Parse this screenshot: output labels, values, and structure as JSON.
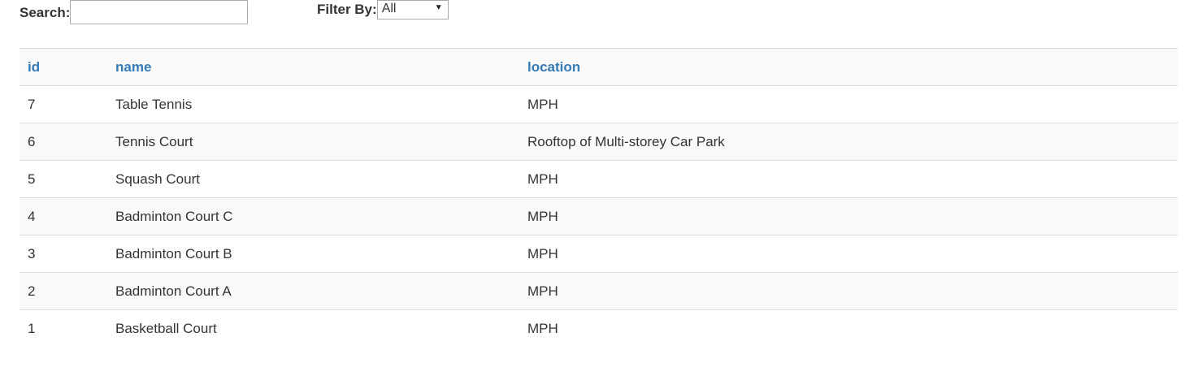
{
  "search": {
    "label": "Search:",
    "value": "",
    "placeholder": ""
  },
  "filter": {
    "label": "Filter By:",
    "selected": "All",
    "caret": "▼"
  },
  "table": {
    "columns": [
      "id",
      "name",
      "location"
    ],
    "rows": [
      {
        "id": "7",
        "name": "Table Tennis",
        "location": "MPH"
      },
      {
        "id": "6",
        "name": "Tennis Court",
        "location": "Rooftop of Multi-storey Car Park"
      },
      {
        "id": "5",
        "name": "Squash Court",
        "location": "MPH"
      },
      {
        "id": "4",
        "name": "Badminton Court C",
        "location": "MPH"
      },
      {
        "id": "3",
        "name": "Badminton Court B",
        "location": "MPH"
      },
      {
        "id": "2",
        "name": "Badminton Court A",
        "location": "MPH"
      },
      {
        "id": "1",
        "name": "Basketball Court",
        "location": "MPH"
      }
    ]
  },
  "colors": {
    "header_link": "#337ab7",
    "stripe": "#f9f9f9",
    "border": "#dddddd",
    "text": "#333333"
  }
}
